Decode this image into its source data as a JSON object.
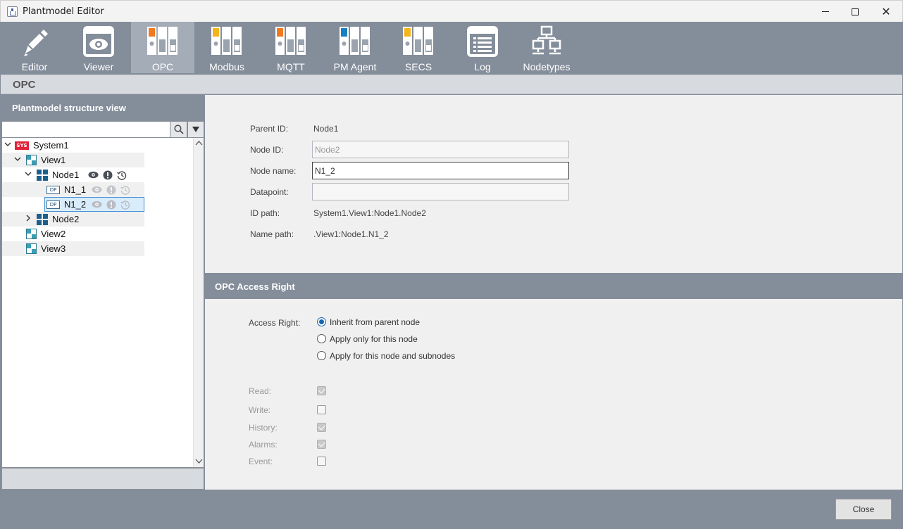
{
  "window": {
    "title": "Plantmodel Editor",
    "minimize": "",
    "maximize": "",
    "close": "✕"
  },
  "toolbar": {
    "items": [
      {
        "label": "Editor",
        "icon": "pencil-icon",
        "active": false
      },
      {
        "label": "Viewer",
        "icon": "eye-window-icon",
        "active": false
      },
      {
        "label": "OPC",
        "icon": "server-rack-orange-icon",
        "active": true
      },
      {
        "label": "Modbus",
        "icon": "server-rack-yellow-icon",
        "active": false
      },
      {
        "label": "MQTT",
        "icon": "server-rack-orange-icon",
        "active": false
      },
      {
        "label": "PM Agent",
        "icon": "server-rack-blue-icon",
        "active": false
      },
      {
        "label": "SECS",
        "icon": "server-rack-yellow-icon",
        "active": false
      },
      {
        "label": "Log",
        "icon": "log-list-icon",
        "active": false
      },
      {
        "label": "Nodetypes",
        "icon": "network-tree-icon",
        "active": false
      }
    ]
  },
  "section": {
    "title": "OPC"
  },
  "left": {
    "header": "Plantmodel structure view",
    "search_value": "",
    "tree": {
      "system": {
        "badge": "SYS",
        "label": "System1"
      },
      "view1": {
        "label": "View1"
      },
      "node1": {
        "label": "Node1"
      },
      "n1_1": {
        "badge": "DP",
        "label": "N1_1"
      },
      "n1_2": {
        "badge": "DP",
        "label": "N1_2"
      },
      "node2": {
        "label": "Node2"
      },
      "view2": {
        "label": "View2"
      },
      "view3": {
        "label": "View3"
      }
    }
  },
  "details": {
    "parent_id_label": "Parent ID:",
    "parent_id_value": "Node1",
    "node_id_label": "Node ID:",
    "node_id_value": "Node2",
    "node_name_label": "Node name:",
    "node_name_value": "N1_2",
    "datapoint_label": "Datapoint:",
    "datapoint_value": "",
    "id_path_label": "ID path:",
    "id_path_value": "System1.View1:Node1.Node2",
    "name_path_label": "Name path:",
    "name_path_value": ".View1:Node1.N1_2"
  },
  "access": {
    "title": "OPC Access Right",
    "label": "Access Right:",
    "options": [
      {
        "label": "Inherit from parent node",
        "selected": true
      },
      {
        "label": "Apply only for this node",
        "selected": false
      },
      {
        "label": "Apply for this node and subnodes",
        "selected": false
      }
    ],
    "rights": [
      {
        "label": "Read:",
        "checked": true
      },
      {
        "label": "Write:",
        "checked": false
      },
      {
        "label": "History:",
        "checked": true
      },
      {
        "label": "Alarms:",
        "checked": true
      },
      {
        "label": "Event:",
        "checked": false
      }
    ]
  },
  "footer": {
    "close_label": "Close"
  },
  "colors": {
    "panel": "#848d9a",
    "accent": "#1464b4",
    "sys_badge": "#e0223a",
    "node": "#1d5f8c"
  }
}
